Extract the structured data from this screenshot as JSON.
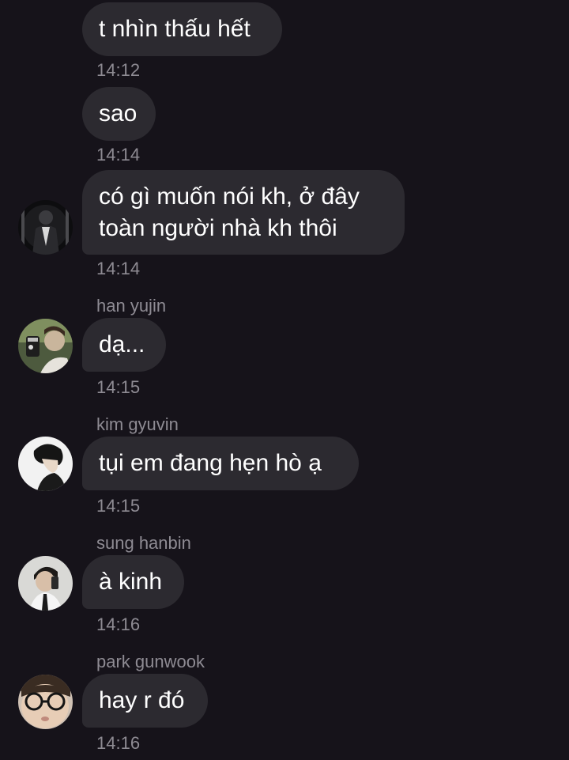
{
  "messages": [
    {
      "text": "t nhìn thấu hết",
      "time": "14:12"
    },
    {
      "text": "sao",
      "time": "14:14"
    },
    {
      "lines": [
        "có gì muốn nói kh, ở đây",
        "toàn người nhà kh thôi"
      ],
      "time": "14:14",
      "avatar": "black-and-white-person-avatar-icon"
    },
    {
      "sender": "han yujin",
      "text": "dạ...",
      "time": "14:15",
      "avatar": "mirror-selfie-avatar-icon"
    },
    {
      "sender": "kim gyuvin",
      "text": "tụi em đang hẹn hò ạ",
      "time": "14:15",
      "avatar": "profile-portrait-avatar-icon"
    },
    {
      "sender": "sung hanbin",
      "text": "à kinh",
      "time": "14:16",
      "avatar": "uniform-selfie-avatar-icon"
    },
    {
      "sender": "park gunwook",
      "text": "hay r đó",
      "time": "14:16",
      "avatar": "glasses-face-avatar-icon"
    }
  ],
  "colors": {
    "background": "#16131a",
    "bubble": "#2c2a30",
    "meta_text": "#8e8b93",
    "message_text": "#ffffff"
  }
}
